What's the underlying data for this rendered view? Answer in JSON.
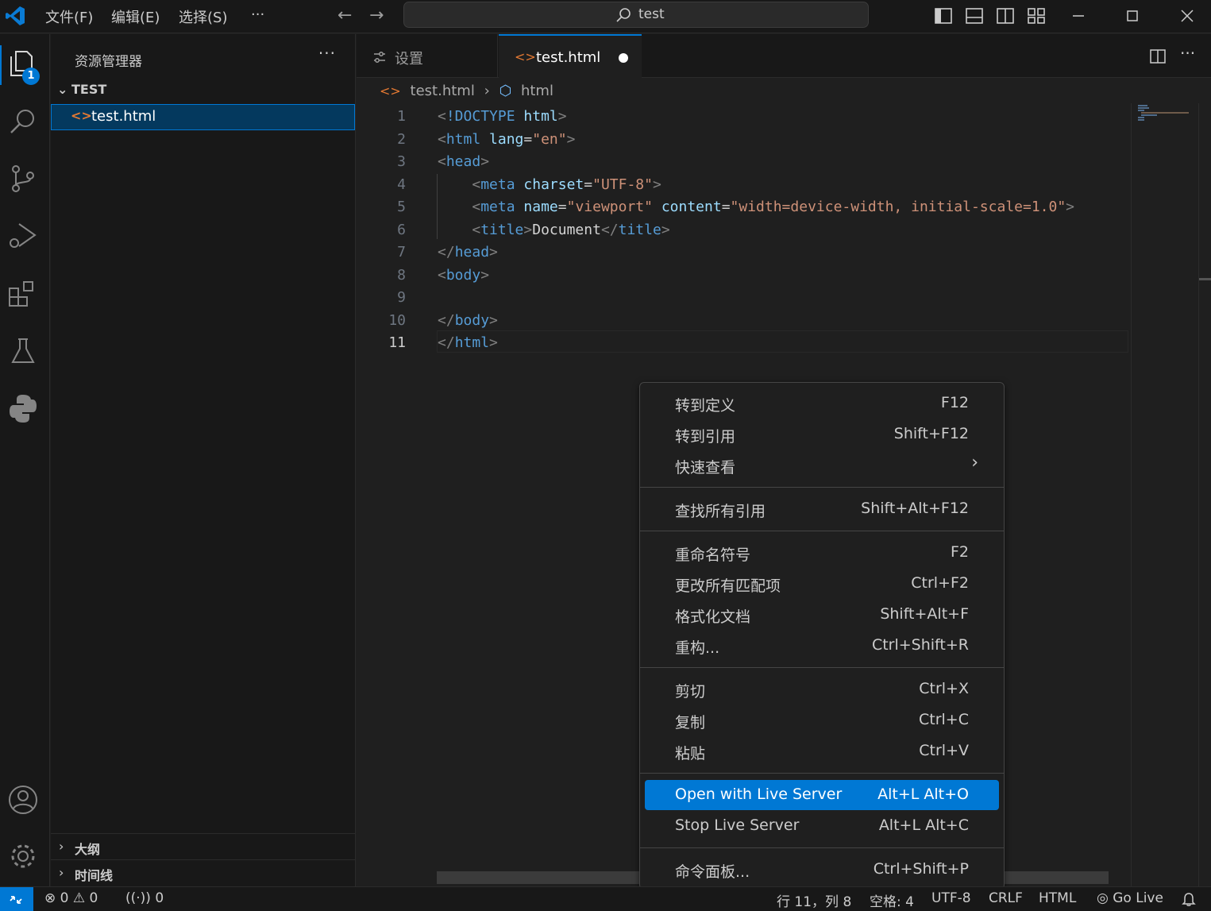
{
  "titlebar": {
    "menus": [
      "文件(F)",
      "编辑(E)",
      "选择(S)"
    ],
    "more": "···",
    "search_text": "test"
  },
  "activitybar": {
    "badge": "1",
    "icons": [
      "explorer-icon",
      "search-icon",
      "source-control-icon",
      "run-debug-icon",
      "extensions-icon",
      "testing-icon",
      "python-icon",
      "account-icon",
      "gear-icon"
    ]
  },
  "sidebar": {
    "title": "资源管理器",
    "more": "···",
    "folder": "TEST",
    "file_icon": "<>",
    "file": "test.html",
    "outline": "大纲",
    "timeline": "时间线"
  },
  "tabs": [
    {
      "label": "设置",
      "icon": "settings-icon"
    },
    {
      "label": "test.html",
      "icon": "<>"
    }
  ],
  "breadcrumb": {
    "file": "test.html",
    "sep": "›",
    "symbol": "html"
  },
  "editor": {
    "line_numbers": [
      "1",
      "2",
      "3",
      "4",
      "5",
      "6",
      "7",
      "8",
      "9",
      "10",
      "11"
    ],
    "current_line": "11",
    "lines": [
      "<!DOCTYPE html>",
      "<html lang=\"en\">",
      "<head>",
      "    <meta charset=\"UTF-8\">",
      "    <meta name=\"viewport\" content=\"width=device-width, initial-scale=1.0\">",
      "    <title>Document</title>",
      "</head>",
      "<body>",
      "",
      "</body>",
      "</html>"
    ]
  },
  "context_menu": {
    "items": [
      {
        "label": "转到定义",
        "key": "F12"
      },
      {
        "label": "转到引用",
        "key": "Shift+F12"
      },
      {
        "label": "快速查看",
        "key": "›"
      },
      {
        "label": "查找所有引用",
        "key": "Shift+Alt+F12"
      },
      {
        "label": "重命名符号",
        "key": "F2"
      },
      {
        "label": "更改所有匹配项",
        "key": "Ctrl+F2"
      },
      {
        "label": "格式化文档",
        "key": "Shift+Alt+F"
      },
      {
        "label": "重构...",
        "key": "Ctrl+Shift+R"
      },
      {
        "label": "剪切",
        "key": "Ctrl+X"
      },
      {
        "label": "复制",
        "key": "Ctrl+C"
      },
      {
        "label": "粘贴",
        "key": "Ctrl+V"
      },
      {
        "label": "Open with Live Server",
        "key": "Alt+L Alt+O"
      },
      {
        "label": "Stop Live Server",
        "key": "Alt+L Alt+C"
      },
      {
        "label": "命令面板...",
        "key": "Ctrl+Shift+P"
      }
    ],
    "highlighted": "Open with Live Server"
  },
  "statusbar": {
    "errors": "0",
    "warnings": "0",
    "ports": "0",
    "position": "行 11，列 8",
    "spaces": "空格: 4",
    "encoding": "UTF-8",
    "eol": "CRLF",
    "language": "HTML",
    "golive": "Go Live"
  },
  "colors": {
    "accent": "#0078d4",
    "html_icon": "#e37933",
    "tag": "#569cd6",
    "attr": "#9cdcfe",
    "string": "#ce9178"
  }
}
